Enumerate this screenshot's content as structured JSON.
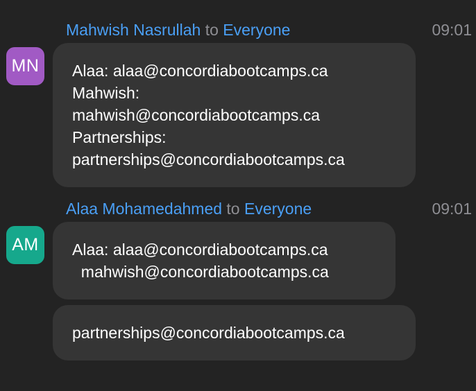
{
  "messages": [
    {
      "sender": "Mahwish Nasrullah",
      "to_word": "to",
      "recipient": "Everyone",
      "time": "09:01",
      "avatar": {
        "initials": "MN",
        "color": "#a15ac4"
      },
      "bubbles": [
        {
          "lines": [
            "Alaa: alaa@concordiabootcamps.ca",
            "Mahwish:",
            "mahwish@concordiabootcamps.ca",
            "Partnerships:",
            "partnerships@concordiabootcamps.ca"
          ]
        }
      ]
    },
    {
      "sender": "Alaa Mohamedahmed",
      "to_word": "to",
      "recipient": "Everyone",
      "time": "09:01",
      "avatar": {
        "initials": "AM",
        "color": "#16a88c"
      },
      "bubbles": [
        {
          "lines": [
            "Alaa: alaa@concordiabootcamps.ca",
            "  mahwish@concordiabootcamps.ca"
          ]
        },
        {
          "lines": [
            "partnerships@concordiabootcamps.ca"
          ]
        }
      ]
    }
  ]
}
